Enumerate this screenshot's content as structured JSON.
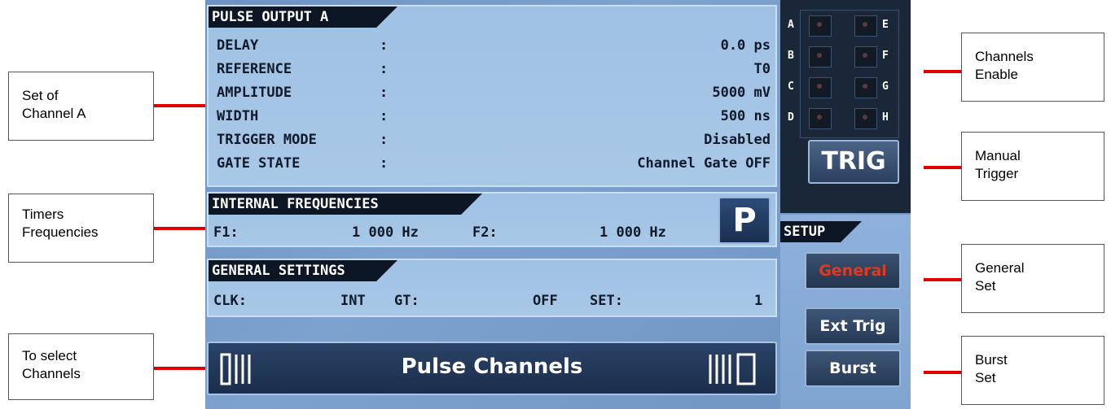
{
  "callouts": {
    "channel_a": [
      "Set of",
      "Channel A"
    ],
    "timers": [
      "Timers",
      "Frequencies"
    ],
    "select": [
      "To select",
      "Channels"
    ],
    "enable": [
      "Channels",
      "Enable"
    ],
    "manual": [
      "Manual",
      "Trigger"
    ],
    "general": [
      "General",
      "Set"
    ],
    "burst": [
      "Burst",
      "Set"
    ]
  },
  "pulse_output": {
    "title": "PULSE OUTPUT A",
    "rows": [
      {
        "label": "DELAY",
        "sep": ":",
        "value": "0.0 ps"
      },
      {
        "label": "REFERENCE",
        "sep": ":",
        "value": "T0"
      },
      {
        "label": "AMPLITUDE",
        "sep": ":",
        "value": "5000 mV"
      },
      {
        "label": "WIDTH",
        "sep": ":",
        "value": "500 ns"
      },
      {
        "label": "TRIGGER MODE",
        "sep": ":",
        "value": "Disabled"
      },
      {
        "label": "GATE STATE",
        "sep": ":",
        "value": "Channel Gate OFF"
      }
    ]
  },
  "internal_frequencies": {
    "title": "INTERNAL FREQUENCIES",
    "f1_label": "F1:",
    "f1_value": "1 000 Hz",
    "f2_label": "F2:",
    "f2_value": "1 000 Hz",
    "p_button": "P"
  },
  "general_settings": {
    "title": "GENERAL SETTINGS",
    "clk_label": "CLK:",
    "clk_value": "INT",
    "gt_label": "GT:",
    "gt_value": "OFF",
    "set_label": "SET:",
    "set_value": "1"
  },
  "pulse_channels": {
    "label": "Pulse Channels"
  },
  "channels": {
    "left": [
      "A",
      "B",
      "C",
      "D"
    ],
    "right": [
      "E",
      "F",
      "G",
      "H"
    ]
  },
  "trig": "TRIG",
  "setup": {
    "title": "SETUP",
    "general": "General",
    "ext_trig": "Ext Trig",
    "burst": "Burst"
  },
  "colors": {
    "callout_line": "#e00000",
    "general_active_text": "#e0391e"
  }
}
